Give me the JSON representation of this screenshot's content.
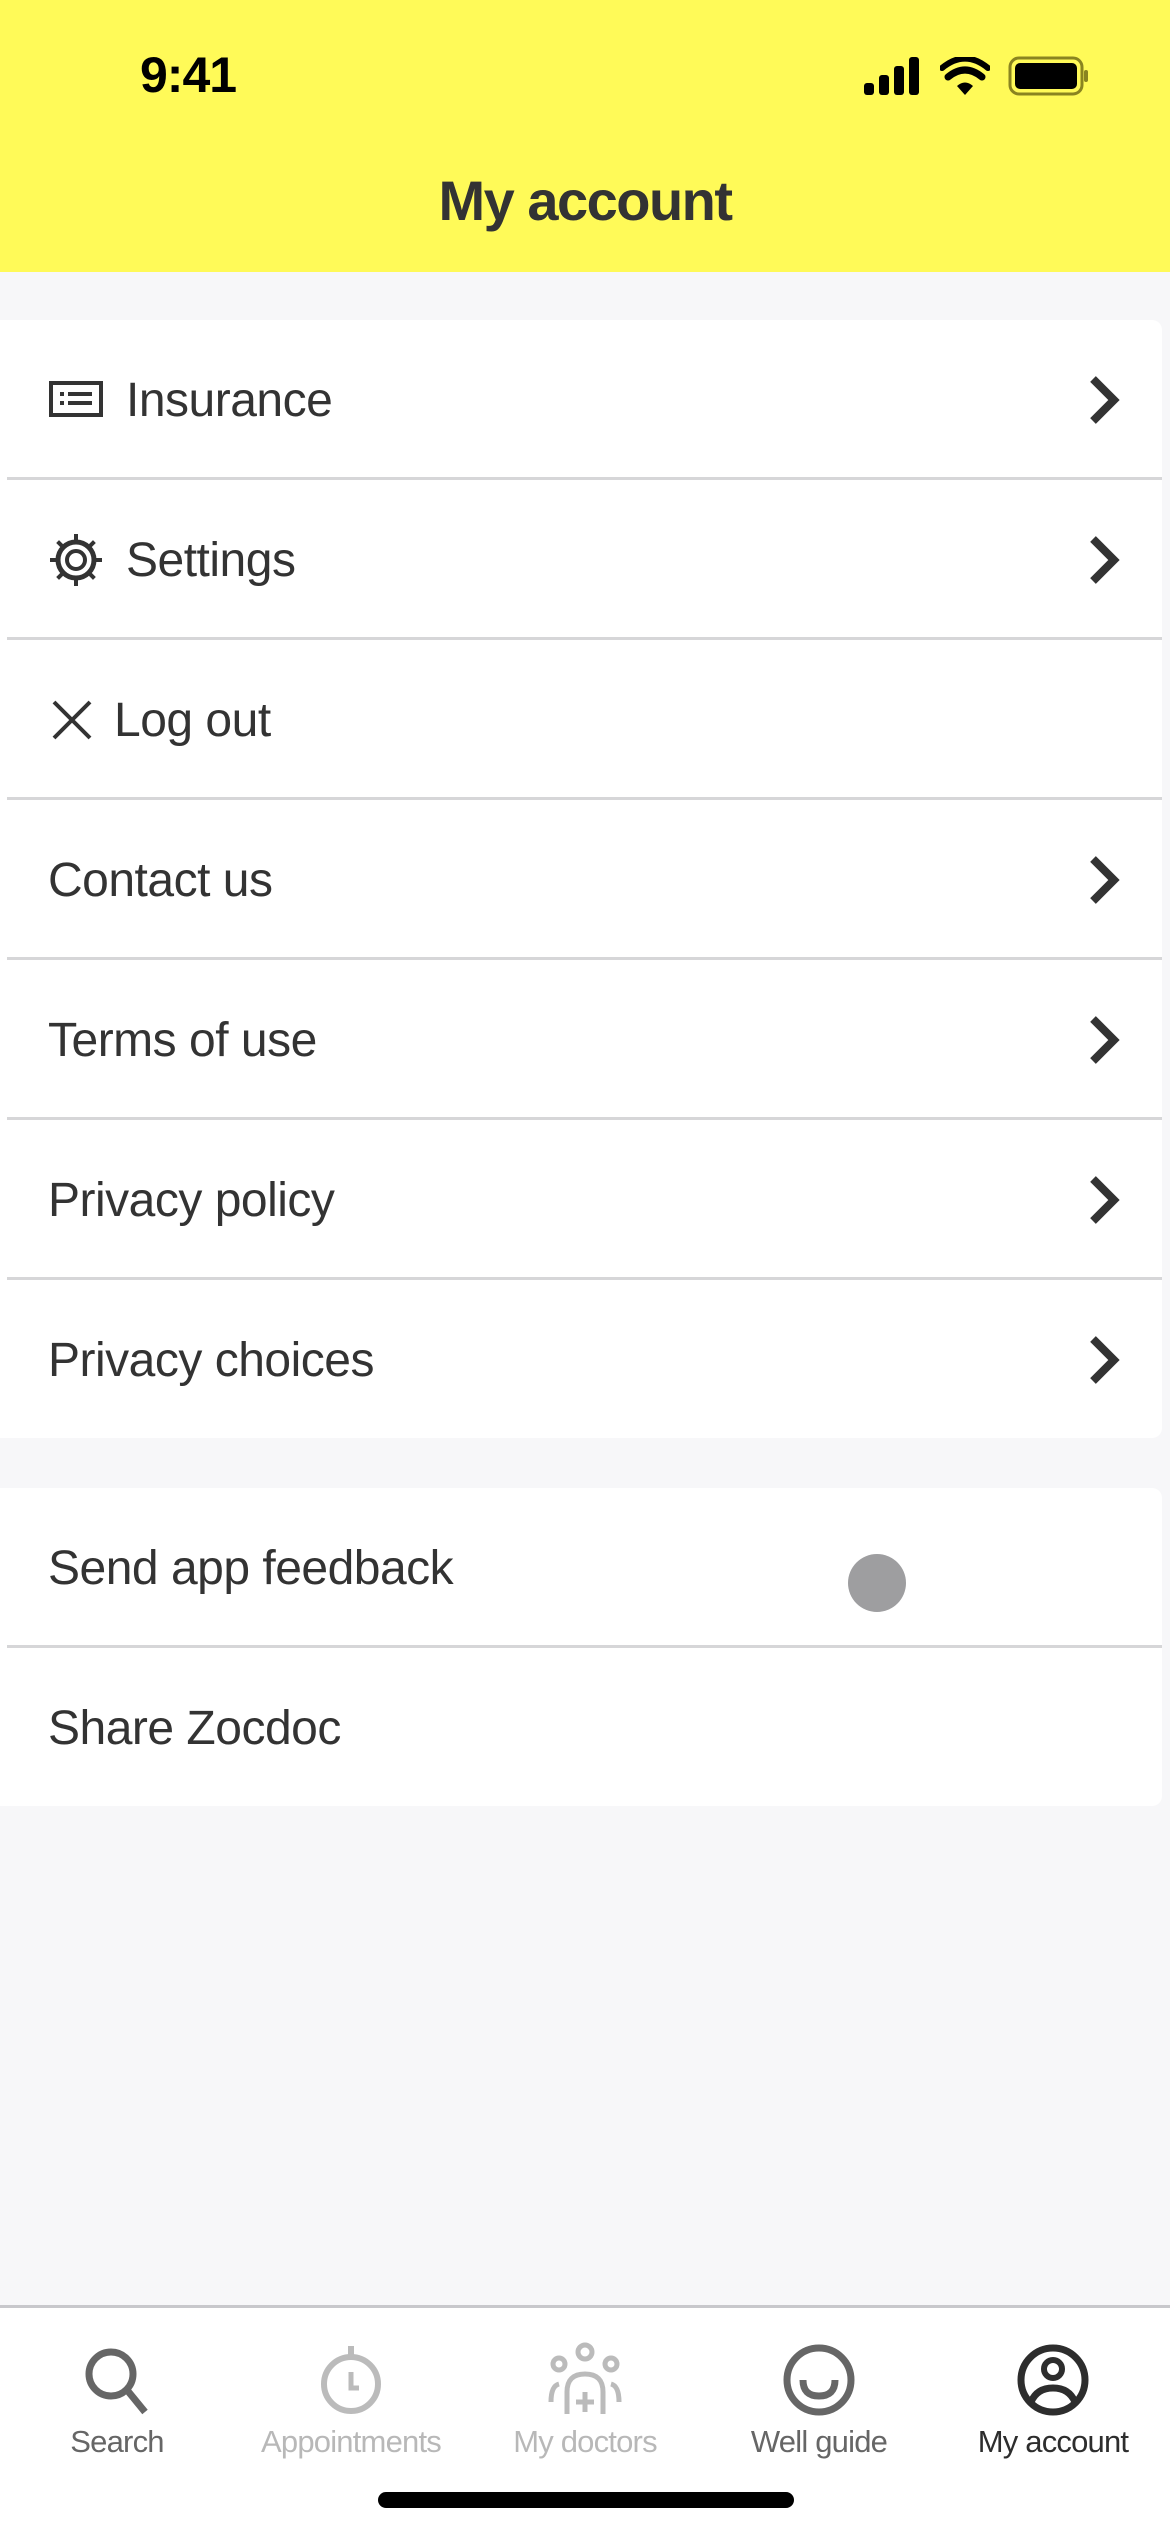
{
  "status_bar": {
    "time": "9:41"
  },
  "header": {
    "title": "My account",
    "background": "#fffa58"
  },
  "menu_primary": [
    {
      "label": "Insurance",
      "icon": "id-card-icon",
      "has_chevron": true
    },
    {
      "label": "Settings",
      "icon": "gear-icon",
      "has_chevron": true
    },
    {
      "label": "Log out",
      "icon": "close-icon",
      "has_chevron": false
    },
    {
      "label": "Contact us",
      "icon": null,
      "has_chevron": true
    },
    {
      "label": "Terms of use",
      "icon": null,
      "has_chevron": true
    },
    {
      "label": "Privacy policy",
      "icon": null,
      "has_chevron": true
    },
    {
      "label": "Privacy choices",
      "icon": null,
      "has_chevron": true
    }
  ],
  "menu_secondary": [
    {
      "label": "Send app feedback"
    },
    {
      "label": "Share Zocdoc"
    }
  ],
  "tabbar": {
    "active": "My account",
    "tabs": [
      {
        "label": "Search",
        "icon": "search-icon",
        "color": "#666666"
      },
      {
        "label": "Appointments",
        "icon": "stopwatch-icon",
        "color": "#b8b8b8"
      },
      {
        "label": "My doctors",
        "icon": "doctors-icon",
        "color": "#b8b8b8"
      },
      {
        "label": "Well guide",
        "icon": "smile-icon",
        "color": "#666666"
      },
      {
        "label": "My account",
        "icon": "account-icon",
        "color": "#2d2d2d"
      }
    ]
  }
}
